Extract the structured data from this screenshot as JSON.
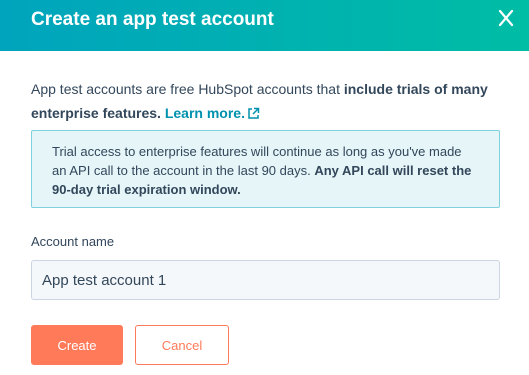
{
  "dialog": {
    "title": "Create an app test account",
    "close_icon": "close-icon",
    "header_color": "#00a4bd"
  },
  "intro": {
    "text_before": "App test accounts are free HubSpot accounts that ",
    "bold_text": "include trials of many enterprise features.",
    "link_text": "Learn more.",
    "link_icon": "external-link-icon"
  },
  "notice": {
    "text": "Trial access to enterprise features will continue as long as you've made an API call to the account in the last 90 days. ",
    "bold_text": "Any API call will reset the 90-day trial expiration window."
  },
  "form": {
    "account_name_label": "Account name",
    "account_name_value": "App test account 1"
  },
  "buttons": {
    "create_label": "Create",
    "cancel_label": "Cancel",
    "accent_color": "#ff7a59"
  }
}
